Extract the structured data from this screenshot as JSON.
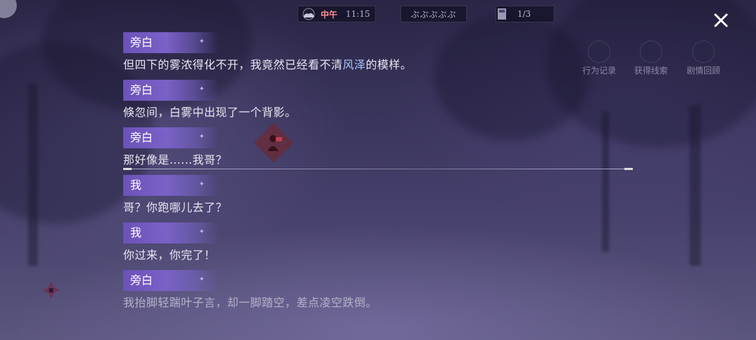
{
  "hud": {
    "weather_icon": "cloud-moon-icon",
    "period": "中午",
    "time": "11:15",
    "hearts": "ぷぷぷぷぷ",
    "book_icon": "book-icon",
    "progress": "1/3"
  },
  "side_menu": [
    {
      "label": "行为记录",
      "icon": "behavior-log-icon"
    },
    {
      "label": "获得线索",
      "icon": "clues-icon"
    },
    {
      "label": "剧情回顾",
      "icon": "story-review-icon"
    }
  ],
  "log": [
    {
      "speaker": "旁白",
      "text_before": "但四下的雾浓得化不开，我竟然已经看不清",
      "highlight": "风泽",
      "text_after": "的模样。"
    },
    {
      "speaker": "旁白",
      "text": "倏忽间，白雾中出现了一个背影。"
    },
    {
      "speaker": "旁白",
      "text": "那好像是……我哥？"
    },
    {
      "speaker": "我",
      "text": "哥？你跑哪儿去了？"
    },
    {
      "speaker": "我",
      "text": "你过来，你完了！"
    },
    {
      "speaker": "旁白",
      "text": "我抬脚轻踹叶子言，却一脚踏空，差点凌空跌倒。"
    }
  ],
  "colors": {
    "speaker_tag": "#7a61c8",
    "highlight": "#a9c4ff",
    "noon": "#ff8f8f"
  }
}
